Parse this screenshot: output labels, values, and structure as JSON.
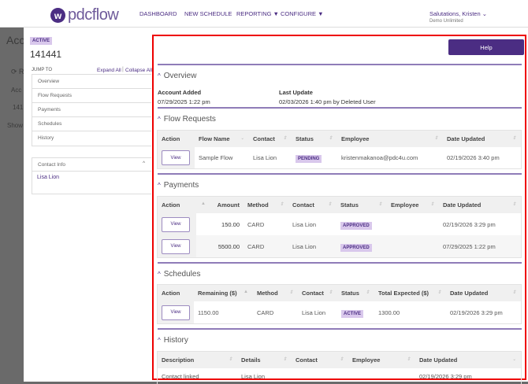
{
  "header": {
    "logo": "pdcflow",
    "nav": [
      "DASHBOARD",
      "NEW SCHEDULE",
      "REPORTING",
      "CONFIGURE"
    ],
    "user": "Salutations, Kristen",
    "org": "Demo Unlimited"
  },
  "background": {
    "title": "Acc",
    "refresh": "R",
    "acc": "Acc",
    "num": "141",
    "show": "Show"
  },
  "account": {
    "status": "ACTIVE",
    "id": "141441"
  },
  "jump": {
    "label": "JUMP TO",
    "expand": "Expand All",
    "collapse": "Collapse All",
    "items": [
      "Overview",
      "Flow Requests",
      "Payments",
      "Schedules",
      "History"
    ]
  },
  "contact_info": {
    "title": "Contact Info",
    "name": "Lisa Lion"
  },
  "help": "Help",
  "overview": {
    "title": "Overview",
    "added_label": "Account Added",
    "added": "07/29/2025 1:22 pm",
    "update_label": "Last Update",
    "update": "02/03/2026 1:40 pm by Deleted User"
  },
  "flow": {
    "title": "Flow Requests",
    "headers": [
      "Action",
      "Flow Name",
      "Contact",
      "Status",
      "Employee",
      "Date Updated"
    ],
    "rows": [
      {
        "action": "View",
        "name": "Sample Flow",
        "contact": "Lisa Lion",
        "status": "PENDING",
        "employee": "kristenmakanoa@pdc4u.com",
        "date": "02/19/2026 3:40 pm"
      }
    ]
  },
  "payments": {
    "title": "Payments",
    "headers": [
      "Action",
      "Amount",
      "Method",
      "Contact",
      "Status",
      "Employee",
      "Date Updated"
    ],
    "rows": [
      {
        "action": "View",
        "amount": "150.00",
        "method": "CARD",
        "contact": "Lisa Lion",
        "status": "APPROVED",
        "employee": "",
        "date": "02/19/2026 3:29 pm"
      },
      {
        "action": "View",
        "amount": "5500.00",
        "method": "CARD",
        "contact": "Lisa Lion",
        "status": "APPROVED",
        "employee": "",
        "date": "07/29/2025 1:22 pm"
      }
    ]
  },
  "schedules": {
    "title": "Schedules",
    "headers": [
      "Action",
      "Remaining ($)",
      "Method",
      "Contact",
      "Status",
      "Total Expected ($)",
      "Date Updated"
    ],
    "rows": [
      {
        "action": "View",
        "remaining": "1150.00",
        "method": "CARD",
        "contact": "Lisa Lion",
        "status": "ACTIVE",
        "total": "1300.00",
        "date": "02/19/2026 3:29 pm"
      }
    ]
  },
  "history": {
    "title": "History",
    "headers": [
      "Description",
      "Details",
      "Contact",
      "Employee",
      "Date Updated"
    ],
    "rows": [
      {
        "description": "Contact linked",
        "details": "Lisa Lion",
        "contact": "",
        "employee": "",
        "date": "02/19/2026 3:29 pm"
      }
    ]
  }
}
